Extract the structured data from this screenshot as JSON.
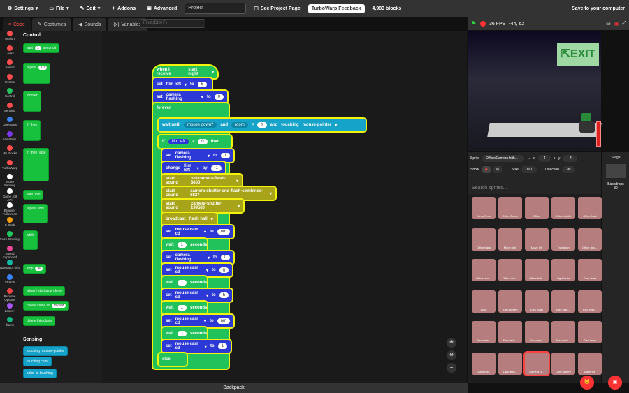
{
  "menubar": {
    "settings": "Settings",
    "file": "File",
    "edit": "Edit",
    "addons": "Addons",
    "advanced": "Advanced",
    "project_title": "Project",
    "see_project": "See Project Page",
    "feedback": "TurboWarp Feedback",
    "blocks": "4,983 blocks",
    "save": "Save to your computer"
  },
  "tabs": {
    "code": "Code",
    "costumes": "Costumes",
    "sounds": "Sounds",
    "variables": "Variables"
  },
  "find_placeholder": "Find (Ctrl+F)",
  "categories": [
    {
      "label": "Motion",
      "color": "#ff4c4c"
    },
    {
      "label": "Looks",
      "color": "#ff4c4c"
    },
    {
      "label": "Sound",
      "color": "#ff4c4c"
    },
    {
      "label": "Events",
      "color": "#ff4c4c"
    },
    {
      "label": "Control",
      "color": "#22c55e"
    },
    {
      "label": "Sensing",
      "color": "#ff4c4c"
    },
    {
      "label": "Operators",
      "color": "#3b82f6"
    },
    {
      "label": "Variables",
      "color": "#7c3aed"
    },
    {
      "label": "My Blocks",
      "color": "#ff4c4c"
    },
    {
      "label": "TurboWarp",
      "color": "#ff4c4c"
    },
    {
      "label": "Video Sensing",
      "color": "#fff"
    },
    {
      "label": "Game Jolt API",
      "color": "#fff"
    },
    {
      "label": "Browser Fullscreen",
      "color": "#fff"
    },
    {
      "label": "S-Grab",
      "color": "#f59e0b"
    },
    {
      "label": "Face Sensing",
      "color": "#22c55e"
    },
    {
      "label": "Sound Expanded",
      "color": "#ec4899"
    },
    {
      "label": "Navigator Info",
      "color": "#14b8a6"
    },
    {
      "label": "Stretch",
      "color": "#3b82f6"
    },
    {
      "label": "Runtime Options",
      "color": "#ef4444"
    },
    {
      "label": "Looks+",
      "color": "#a855f7"
    },
    {
      "label": "Iframe",
      "color": "#10b981"
    }
  ],
  "palette": {
    "control": "Control",
    "sensing": "Sensing",
    "wait": "wait",
    "seconds": "seconds",
    "one": "1",
    "ten": "10",
    "repeat": "repeat",
    "forever": "forever",
    "if": "if",
    "then": "then",
    "else": "else",
    "wait_until": "wait until",
    "repeat_until": "repeat until",
    "while": "while",
    "stop": "stop",
    "all": "all",
    "start_clone": "when I start as a clone",
    "create_clone": "create clone of",
    "myself": "myself",
    "delete_clone": "delete this clone",
    "touching": "touching",
    "mouse_pointer": "mouse-pointer",
    "touching_color": "touching color",
    "color": "color",
    "is_touching": "is touching"
  },
  "script": {
    "hat": "when I receive",
    "hat_msg": "start night",
    "set": "set",
    "to": "to",
    "change": "change",
    "by": "by",
    "film_left": "film left",
    "five": "5",
    "camera_flashing": "camera flashing",
    "zero": "0",
    "forever": "forever",
    "wait_until": "wait until",
    "mouse_down": "mouse down?",
    "and": "and",
    "room": "room",
    "eq": "=",
    "h": "h",
    "touching": "touching",
    "mouse_pointer": "mouse-pointer",
    "if": "if",
    "gt": ">",
    "then": "then",
    "one": "1",
    "minus_one": "-1",
    "start_sound": "start sound",
    "snd1": "old-camera-flash-6800",
    "snd2": "camera-shutter-and-flash-combined-6827",
    "snd3": "camera-shutter-199580",
    "broadcast": "broadcast",
    "flash_hall": "flash hall",
    "mouse_cam_cd": "mouse cam cd",
    "nm": "nm",
    "wait": "wait",
    "seconds": "seconds",
    "g": "g",
    "else": "else"
  },
  "stage": {
    "fps": "36 FPS",
    "coords": "-44, 62"
  },
  "sprite_info": {
    "sprite_label": "Sprite",
    "sprite_name": "Office/Camera hitb...",
    "x": "4",
    "y": "-4",
    "show": "Show",
    "size_label": "Size",
    "size": "100",
    "direction_label": "Direction",
    "direction": "90"
  },
  "search_placeholder": "Search sprites...",
  "sprites": [
    "Menu Pres",
    "Office Owner",
    "Office",
    "Office middle",
    "Office front",
    "Office back",
    "Move right",
    "Move left",
    "Transition",
    "Office cloc...",
    "Office cloc...",
    "Office cloc...",
    "Office butt...",
    "Light lever",
    "Door lever",
    "Door",
    "Elec screen",
    "Elec main",
    "Elec rese...",
    "Elec rese...",
    "Elec resis...",
    "Elec resis...",
    "Elec resis...",
    "Elec resis...",
    "Elec lever",
    "Darkness",
    "Darkness...",
    "Camera hi...",
    "Cam battery",
    "Batteries"
  ],
  "selected_sprite": 27,
  "stage_panel": {
    "stage": "Stage",
    "backdrops": "Backdrops",
    "count": "30"
  },
  "backpack": "Backpack"
}
